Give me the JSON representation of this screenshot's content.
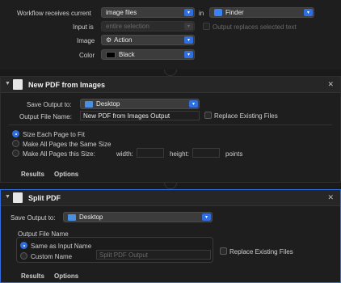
{
  "top": {
    "workflow_label": "Workflow receives current",
    "workflow_value": "image files",
    "in_label": "in",
    "in_value": "Finder",
    "input_label": "Input is",
    "input_value": "entire selection",
    "output_replaces_label": "Output replaces selected text",
    "image_label": "Image",
    "image_value": "Action",
    "color_label": "Color",
    "color_value": "Black"
  },
  "pdf_from_images": {
    "title": "New PDF from Images",
    "save_output_label": "Save Output to:",
    "save_output_value": "Desktop",
    "output_file_label": "Output File Name:",
    "output_file_value": "New PDF from Images Output",
    "replace_label": "Replace Existing Files",
    "option1": "Size Each Page to Fit",
    "option2": "Make All Pages the Same Size",
    "option3": "Make All Pages this Size:",
    "width_label": "width:",
    "height_label": "height:",
    "points_label": "points",
    "tab_results": "Results",
    "tab_options": "Options"
  },
  "split_pdf": {
    "title": "Split PDF",
    "save_output_label": "Save Output to:",
    "save_output_value": "Desktop",
    "group_label": "Output File Name",
    "same_as_input": "Same as Input Name",
    "custom_name": "Custom Name",
    "custom_placeholder": "Split PDF Output",
    "replace_label": "Replace Existing Files",
    "tab_results": "Results",
    "tab_options": "Options"
  }
}
